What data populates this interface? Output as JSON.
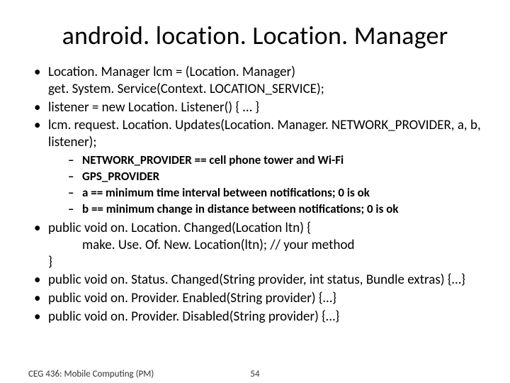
{
  "title": "android. location. Location. Manager",
  "bullets": {
    "b1_line1": "Location. Manager lcm = (Location. Manager)",
    "b1_line2": "get. System. Service(Context. LOCATION_SERVICE);",
    "b2": "listener = new Location. Listener() { … }",
    "b3": "lcm. request. Location. Updates(Location. Manager. NETWORK_PROVIDER, a, b, listener);",
    "sub1": "NETWORK_PROVIDER == cell phone tower and Wi-Fi",
    "sub2": "GPS_PROVIDER",
    "sub3": "a == minimum time interval between notifications; 0 is ok",
    "sub4": "b == minimum change in distance between notifications;  0 is ok",
    "b4_line1": "public void on. Location. Changed(Location ltn) {",
    "b4_line2": "make. Use. Of. New. Location(ltn);               // your method",
    "b4_line3": "}",
    "b5": "public void on. Status. Changed(String provider, int status, Bundle extras) {…}",
    "b6": "public void on. Provider. Enabled(String provider) {…}",
    "b7": "public void on. Provider. Disabled(String provider) {…}"
  },
  "footer": {
    "left": "CEG 436: Mobile Computing (PM)",
    "page": "54"
  }
}
